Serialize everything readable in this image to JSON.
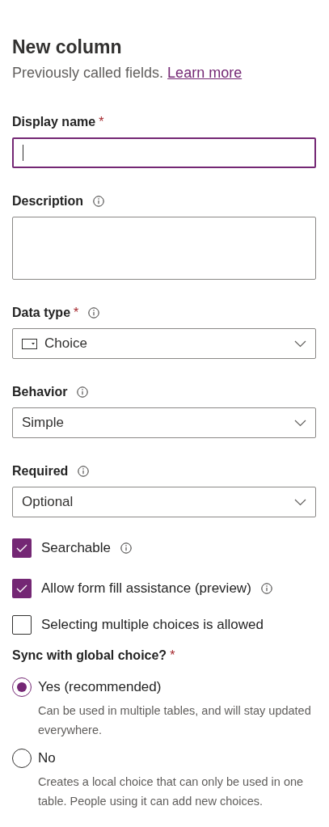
{
  "panel": {
    "title": "New column",
    "subtitle": "Previously called fields.",
    "link": "Learn more"
  },
  "fields": [
    {
      "kind": "text",
      "label": "Display name",
      "marker": "*",
      "info": false,
      "focused": true
    },
    {
      "kind": "textarea",
      "label": "Description",
      "info": true,
      "focused": false
    },
    {
      "kind": "select",
      "label": "Data type",
      "marker": "*",
      "info": true,
      "focused": false,
      "value": "Choice",
      "value_icon": true
    },
    {
      "kind": "select",
      "label": "Behavior",
      "info": true,
      "focused": false,
      "value": "Simple",
      "value_icon": false
    },
    {
      "kind": "select",
      "label": "Required",
      "info": true,
      "focused": false,
      "value": "Optional",
      "value_icon": false
    }
  ],
  "checkboxes": [
    {
      "label": "Searchable",
      "checked": true,
      "info": true
    },
    {
      "label": "Allow form fill assistance (preview)",
      "checked": true,
      "info": true
    },
    {
      "label": "Selecting multiple choices is allowed",
      "checked": false,
      "info": false
    }
  ],
  "sync": {
    "label": "Sync with global choice?",
    "marker": "*",
    "options": [
      {
        "label": "Yes (recommended)",
        "description": "Can be used in multiple tables, and will stay updated everywhere.",
        "selected": true
      },
      {
        "label": "No",
        "description": "Creates a local choice that can only be used in one table. People using it can add new choices.",
        "selected": false
      }
    ]
  }
}
